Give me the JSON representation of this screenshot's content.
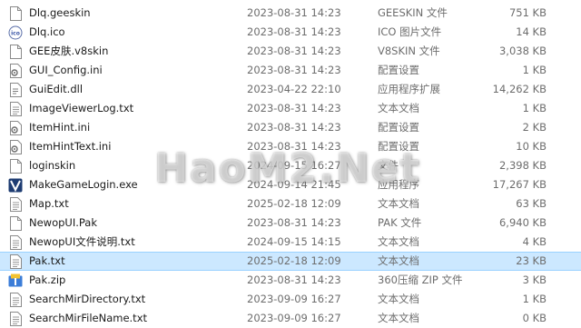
{
  "files": [
    {
      "name": "Dlq.geeskin",
      "date": "2023-08-31 14:23",
      "type": "GEESKIN 文件",
      "size": "751 KB",
      "icon": "blank-file-icon"
    },
    {
      "name": "Dlq.ico",
      "date": "2023-08-31 14:23",
      "type": "ICO 图片文件",
      "size": "14 KB",
      "icon": "ico-image-icon"
    },
    {
      "name": "GEE皮肤.v8skin",
      "date": "2023-08-31 14:23",
      "type": "V8SKIN 文件",
      "size": "3,038 KB",
      "icon": "blank-file-icon"
    },
    {
      "name": "GUI_Config.ini",
      "date": "2023-08-31 14:23",
      "type": "配置设置",
      "size": "1 KB",
      "icon": "config-file-icon"
    },
    {
      "name": "GuiEdit.dll",
      "date": "2023-04-22 22:10",
      "type": "应用程序扩展",
      "size": "14,262 KB",
      "icon": "dll-file-icon"
    },
    {
      "name": "ImageViewerLog.txt",
      "date": "2023-08-31 14:23",
      "type": "文本文档",
      "size": "1 KB",
      "icon": "text-file-icon"
    },
    {
      "name": "ItemHint.ini",
      "date": "2023-08-31 14:23",
      "type": "配置设置",
      "size": "2 KB",
      "icon": "config-file-icon"
    },
    {
      "name": "ItemHintText.ini",
      "date": "2023-08-31 14:23",
      "type": "配置设置",
      "size": "10 KB",
      "icon": "config-file-icon"
    },
    {
      "name": "loginskin",
      "date": "2024-09-15 16:27",
      "type": "文件",
      "size": "2,398 KB",
      "icon": "blank-file-icon"
    },
    {
      "name": "MakeGameLogin.exe",
      "date": "2024-09-14 21:45",
      "type": "应用程序",
      "size": "17,267 KB",
      "icon": "app-exe-icon"
    },
    {
      "name": "Map.txt",
      "date": "2025-02-18 12:09",
      "type": "文本文档",
      "size": "63 KB",
      "icon": "text-file-icon"
    },
    {
      "name": "NewopUI.Pak",
      "date": "2023-08-31 14:23",
      "type": "PAK 文件",
      "size": "6,940 KB",
      "icon": "blank-file-icon"
    },
    {
      "name": "NewopUI文件说明.txt",
      "date": "2024-09-15 14:15",
      "type": "文本文档",
      "size": "4 KB",
      "icon": "text-file-icon"
    },
    {
      "name": "Pak.txt",
      "date": "2025-02-18 12:09",
      "type": "文本文档",
      "size": "23 KB",
      "icon": "text-file-icon",
      "selected": true
    },
    {
      "name": "Pak.zip",
      "date": "2023-08-31 14:23",
      "type": "360压缩 ZIP 文件",
      "size": "3 KB",
      "icon": "zip-archive-icon"
    },
    {
      "name": "SearchMirDirectory.txt",
      "date": "2023-09-09 16:27",
      "type": "文本文档",
      "size": "1 KB",
      "icon": "text-file-icon"
    },
    {
      "name": "SearchMirFileName.txt",
      "date": "2023-09-09 16:27",
      "type": "文本文档",
      "size": "0 KB",
      "icon": "text-file-icon"
    }
  ],
  "watermark": "HaoM2.Net",
  "colors": {
    "selection": "#cce8ff",
    "selection_border": "#99d1ff",
    "muted_text": "#6d6d6d"
  }
}
